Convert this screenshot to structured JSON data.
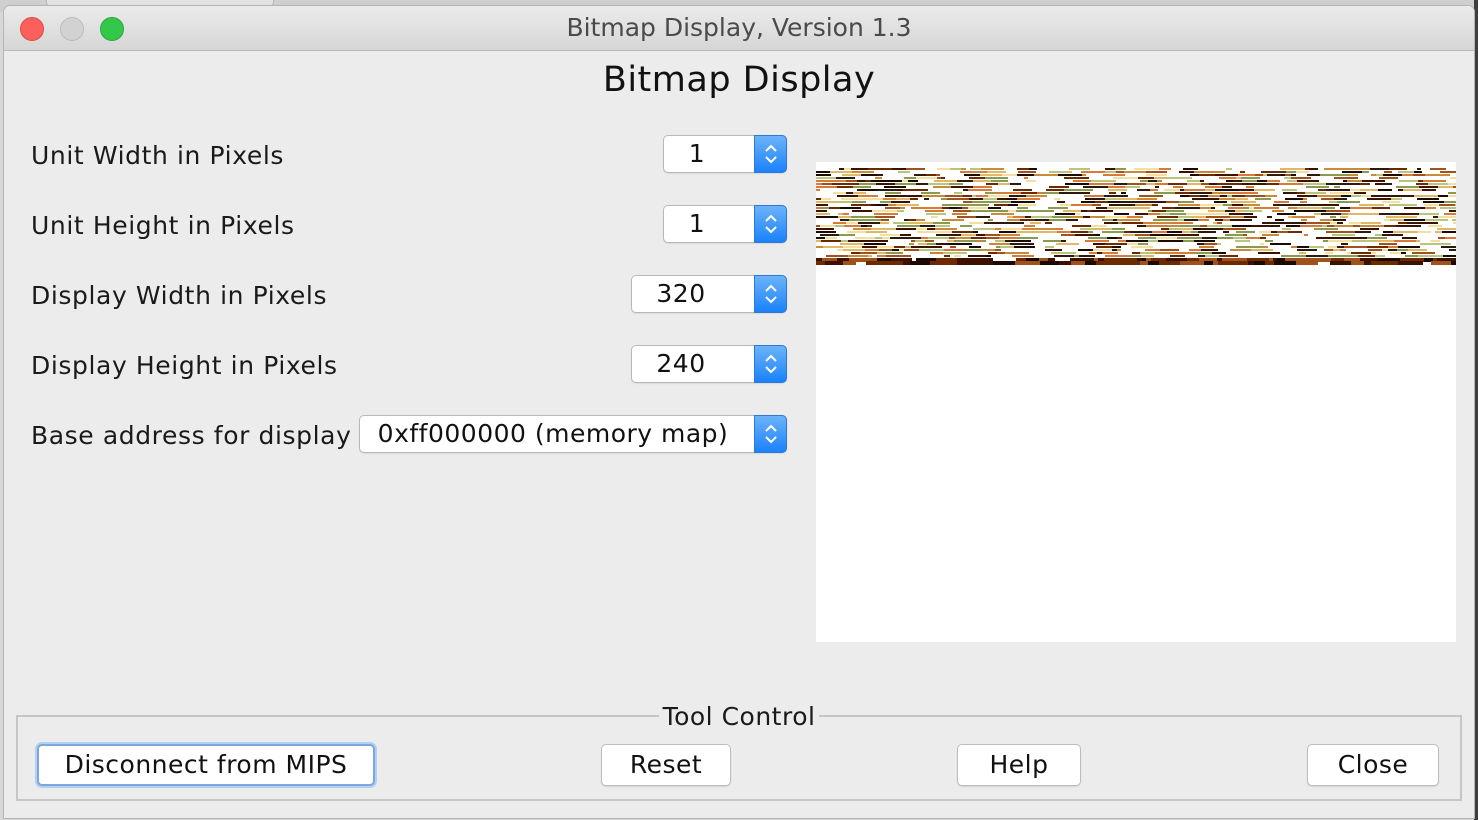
{
  "window": {
    "title": "Bitmap Display, Version 1.3"
  },
  "heading": "Bitmap Display",
  "settings": [
    {
      "label": "Unit Width in Pixels",
      "value": "1"
    },
    {
      "label": "Unit Height in Pixels",
      "value": "1"
    },
    {
      "label": "Display Width in Pixels",
      "value": "320"
    },
    {
      "label": "Display Height in Pixels",
      "value": "240"
    },
    {
      "label": "Base address for display",
      "value": "0xff000000 (memory map)"
    }
  ],
  "tool_control": {
    "title": "Tool Control",
    "buttons": {
      "disconnect": "Disconnect from MIPS",
      "reset": "Reset",
      "help": "Help",
      "close": "Close"
    }
  },
  "colors": {
    "accent": "#1a82fb",
    "window_bg": "#ececec",
    "close_light": "#fc605c",
    "zoom_light": "#34c84a"
  },
  "icons": {
    "combo_arrows": "up-down-chevron-icon"
  }
}
